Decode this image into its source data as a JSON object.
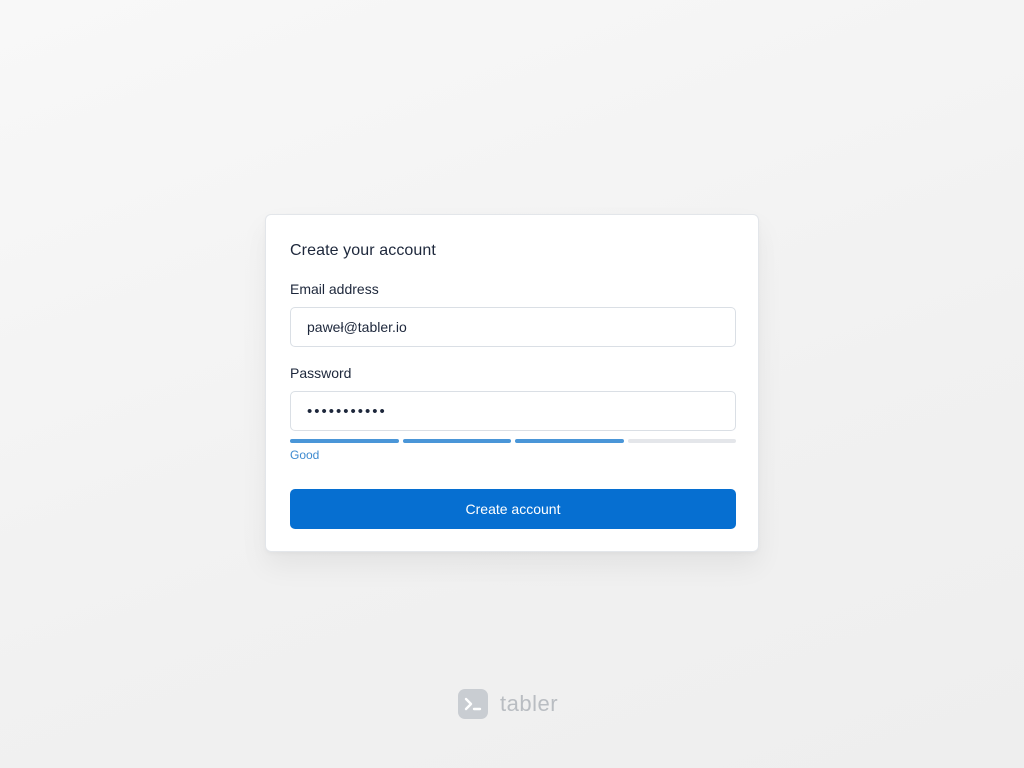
{
  "form": {
    "title": "Create your account",
    "email_label": "Email address",
    "email_value": "paweł@tabler.io",
    "password_label": "Password",
    "password_value": "password123",
    "strength": {
      "filled_segments": 3,
      "total_segments": 4,
      "label": "Good"
    },
    "submit_label": "Create account"
  },
  "brand": {
    "name": "tabler",
    "icon": "terminal-logo-icon"
  },
  "colors": {
    "accent": "#066fd1",
    "strength": "#4a96d8",
    "strength_text": "#3d8ad0"
  }
}
